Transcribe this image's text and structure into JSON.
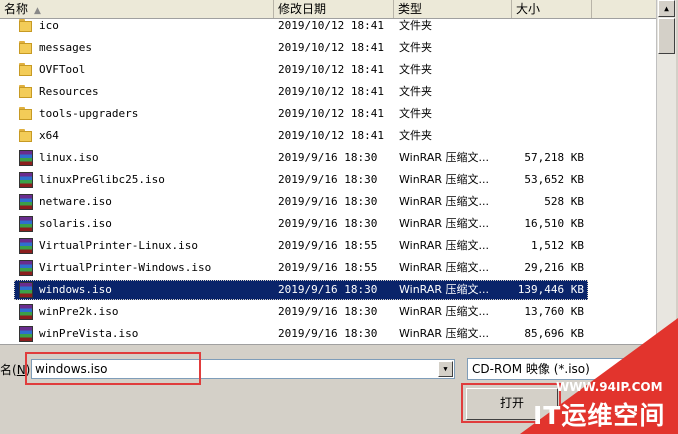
{
  "columns": {
    "name": "名称",
    "date": "修改日期",
    "type": "类型",
    "size": "大小"
  },
  "files": [
    {
      "icon": "folder-icon",
      "name": "ico",
      "date": "2019/10/12 18:41",
      "type": "文件夹",
      "size": ""
    },
    {
      "icon": "folder-icon",
      "name": "messages",
      "date": "2019/10/12 18:41",
      "type": "文件夹",
      "size": ""
    },
    {
      "icon": "folder-icon",
      "name": "OVFTool",
      "date": "2019/10/12 18:41",
      "type": "文件夹",
      "size": ""
    },
    {
      "icon": "folder-icon",
      "name": "Resources",
      "date": "2019/10/12 18:41",
      "type": "文件夹",
      "size": ""
    },
    {
      "icon": "folder-icon",
      "name": "tools-upgraders",
      "date": "2019/10/12 18:41",
      "type": "文件夹",
      "size": ""
    },
    {
      "icon": "folder-icon",
      "name": "x64",
      "date": "2019/10/12 18:41",
      "type": "文件夹",
      "size": ""
    },
    {
      "icon": "winrar-icon",
      "name": "linux.iso",
      "date": "2019/9/16 18:30",
      "type": "WinRAR 压缩文...",
      "size": "57,218 KB"
    },
    {
      "icon": "winrar-icon",
      "name": "linuxPreGlibc25.iso",
      "date": "2019/9/16 18:30",
      "type": "WinRAR 压缩文...",
      "size": "53,652 KB"
    },
    {
      "icon": "winrar-icon",
      "name": "netware.iso",
      "date": "2019/9/16 18:30",
      "type": "WinRAR 压缩文...",
      "size": "528 KB"
    },
    {
      "icon": "winrar-icon",
      "name": "solaris.iso",
      "date": "2019/9/16 18:30",
      "type": "WinRAR 压缩文...",
      "size": "16,510 KB"
    },
    {
      "icon": "winrar-icon",
      "name": "VirtualPrinter-Linux.iso",
      "date": "2019/9/16 18:55",
      "type": "WinRAR 压缩文...",
      "size": "1,512 KB"
    },
    {
      "icon": "winrar-icon",
      "name": "VirtualPrinter-Windows.iso",
      "date": "2019/9/16 18:55",
      "type": "WinRAR 压缩文...",
      "size": "29,216 KB"
    },
    {
      "icon": "winrar-icon",
      "name": "windows.iso",
      "date": "2019/9/16 18:30",
      "type": "WinRAR 压缩文...",
      "size": "139,446 KB",
      "selected": true
    },
    {
      "icon": "winrar-icon",
      "name": "winPre2k.iso",
      "date": "2019/9/16 18:30",
      "type": "WinRAR 压缩文...",
      "size": "13,760 KB"
    },
    {
      "icon": "winrar-icon",
      "name": "winPreVista.iso",
      "date": "2019/9/16 18:30",
      "type": "WinRAR 压缩文...",
      "size": "85,696 KB"
    }
  ],
  "filename": {
    "label_prefix": "名(",
    "label_key": "N",
    "label_suffix": "):",
    "value": "windows.iso"
  },
  "filetype": {
    "value": "CD-ROM 映像 (*.iso)"
  },
  "open_button": {
    "label": "打开"
  },
  "watermark": {
    "url": "WWW.94IP.COM",
    "brand": "IT运维空间"
  },
  "accent_colors": {
    "selection": "#0a246a",
    "highlight": "#e03c3c",
    "watermark": "#e2342d"
  }
}
